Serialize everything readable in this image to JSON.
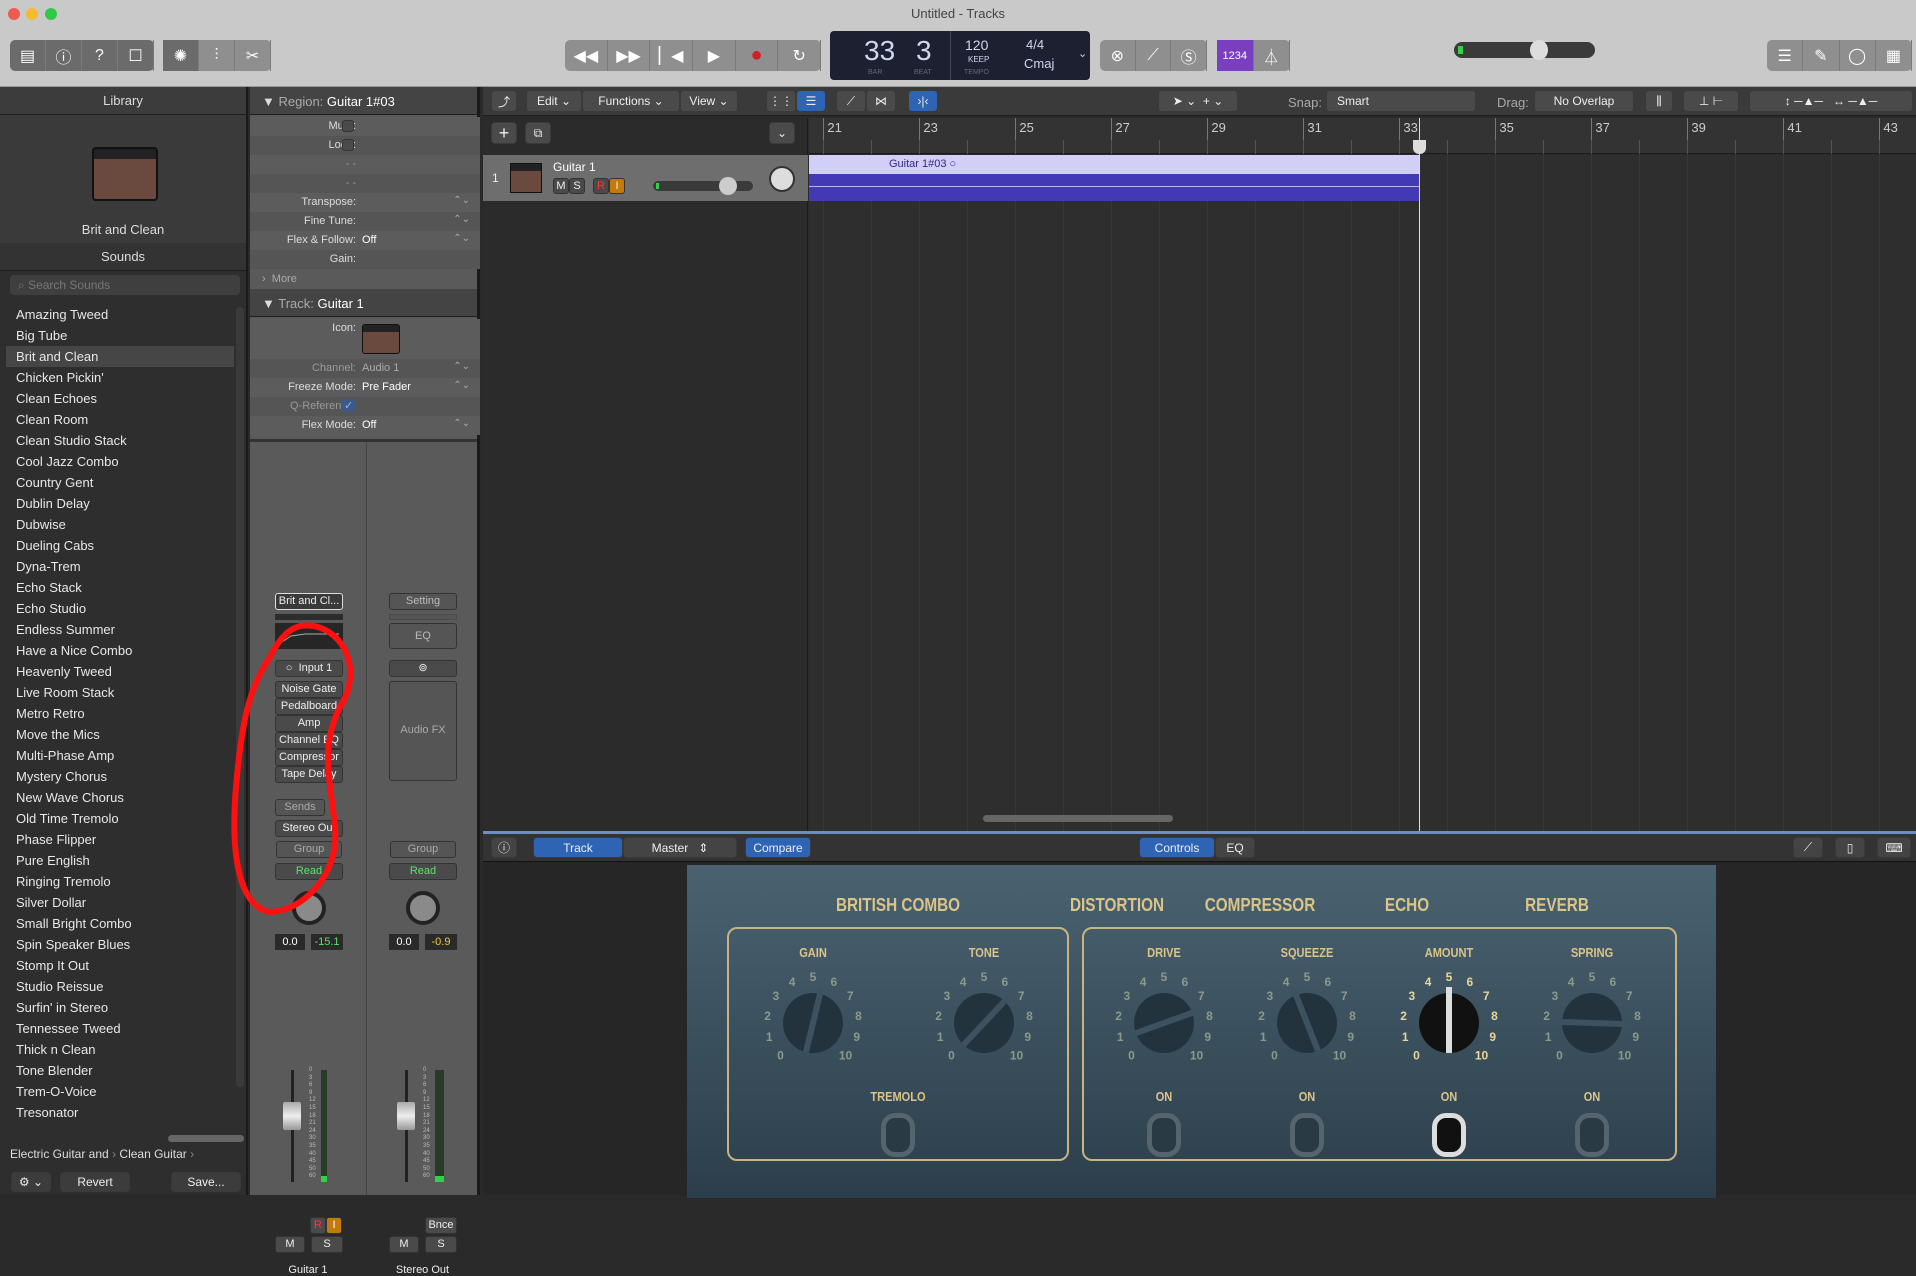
{
  "window": {
    "title": "Untitled - Tracks"
  },
  "colors": {
    "region_header": "#d2cff6",
    "region_body": "#4439b5",
    "accent_blue": "#2f64b4",
    "plugin_gold": "#d9c48a",
    "record": "#d02020",
    "count_in_purple": "#7a3fc0"
  },
  "toolbar": {
    "left_icons": [
      "library-icon",
      "inspector-icon",
      "quick-help-icon",
      "toolbar-icon"
    ],
    "edit_icons": [
      "smart-controls-icon",
      "mixer-icon",
      "editors-scissors-icon"
    ],
    "transport": [
      "rewind-icon",
      "fast-forward-icon",
      "go-to-start-icon",
      "play-icon",
      "record-icon",
      "cycle-icon"
    ],
    "lcd": {
      "bar": "33",
      "beat": "3",
      "bar_label": "BAR",
      "beat_label": "BEAT",
      "tempo": "120",
      "keep": "KEEP",
      "tempo_label": "TEMPO",
      "signature": "4/4",
      "key": "Cmaj"
    },
    "mode_icons": [
      "replace-icon",
      "tuner-icon",
      "solo-icon"
    ],
    "count_in": "1234",
    "master_volume": 0.6,
    "right_icons": [
      "list-editors-icon",
      "notepad-icon",
      "loop-browser-icon",
      "browser-icon"
    ]
  },
  "library": {
    "header": "Library",
    "patch_name": "Brit and Clean",
    "sounds_label": "Sounds",
    "search_placeholder": "Search Sounds",
    "items": [
      "Amazing Tweed",
      "Big Tube",
      "Brit and Clean",
      "Chicken Pickin'",
      "Clean Echoes",
      "Clean Room",
      "Clean Studio Stack",
      "Cool Jazz Combo",
      "Country Gent",
      "Dublin Delay",
      "Dubwise",
      "Dueling Cabs",
      "Dyna-Trem",
      "Echo Stack",
      "Echo Studio",
      "Endless Summer",
      "Have a Nice Combo",
      "Heavenly Tweed",
      "Live Room Stack",
      "Metro Retro",
      "Move the Mics",
      "Multi-Phase Amp",
      "Mystery Chorus",
      "New Wave Chorus",
      "Old Time Tremolo",
      "Phase Flipper",
      "Pure English",
      "Ringing Tremolo",
      "Silver Dollar",
      "Small Bright Combo",
      "Spin Speaker Blues",
      "Stomp It Out",
      "Studio Reissue",
      "Surfin' in Stereo",
      "Tennessee Tweed",
      "Thick n Clean",
      "Tone Blender",
      "Trem-O-Voice",
      "Tresonator"
    ],
    "selected": "Brit and Clean",
    "breadcrumb": [
      "Electric Guitar and",
      "Clean Guitar"
    ],
    "revert": "Revert",
    "save": "Save..."
  },
  "inspector": {
    "region_label": "Region:",
    "region_name": "Guitar 1#03",
    "region_rows": [
      {
        "label": "Mute:",
        "value": ""
      },
      {
        "label": "Loop:",
        "value": ""
      },
      {
        "label": "- -",
        "value": ""
      },
      {
        "label": "- -",
        "value": ""
      },
      {
        "label": "Transpose:",
        "value": ""
      },
      {
        "label": "Fine Tune:",
        "value": ""
      },
      {
        "label": "Flex & Follow:",
        "value": "Off"
      },
      {
        "label": "Gain:",
        "value": ""
      }
    ],
    "more": "More",
    "track_label": "Track:",
    "track_name": "Guitar 1",
    "track_rows": [
      {
        "label": "Icon:",
        "value": ""
      },
      {
        "label": "Channel:",
        "value": "Audio 1"
      },
      {
        "label": "Freeze Mode:",
        "value": "Pre Fader"
      },
      {
        "label": "Q-Reference:",
        "value": "✓"
      },
      {
        "label": "Flex Mode:",
        "value": "Off"
      }
    ],
    "strip1": {
      "setting": "Brit and Cl...",
      "input": "Input 1",
      "plugins": [
        "Noise Gate",
        "Pedalboard",
        "Amp",
        "Channel EQ",
        "Compressor",
        "Tape Delay"
      ],
      "sends": "Sends",
      "output": "Stereo Out",
      "group": "Group",
      "automation": "Read",
      "volume": "0.0",
      "peak": "-15.1",
      "r": "R",
      "i": "I",
      "m": "M",
      "s": "S",
      "name": "Guitar 1"
    },
    "strip2": {
      "setting": "Setting",
      "eq": "EQ",
      "audio_fx": "Audio FX",
      "group": "Group",
      "automation": "Read",
      "volume": "0.0",
      "peak": "-0.9",
      "bnce": "Bnce",
      "m": "M",
      "s": "S",
      "name": "Stereo Out"
    },
    "meter_scale": [
      "0",
      "3",
      "6",
      "9",
      "12",
      "15",
      "18",
      "21",
      "24",
      "30",
      "35",
      "40",
      "45",
      "50",
      "60"
    ]
  },
  "tracks": {
    "menus": [
      "Edit",
      "Functions",
      "View"
    ],
    "snap_label": "Snap:",
    "snap": "Smart",
    "drag_label": "Drag:",
    "drag": "No Overlap",
    "ruler": [
      "21",
      "23",
      "25",
      "27",
      "29",
      "31",
      "33",
      "35",
      "37",
      "39",
      "41",
      "43"
    ],
    "playhead_bar": 33.4,
    "track": {
      "number": "1",
      "name": "Guitar 1",
      "m": "M",
      "s": "S",
      "r": "R",
      "i": "I",
      "volume": 0.75
    },
    "region": {
      "name": "Guitar 1#03",
      "start_bar": 20.7,
      "end_bar": 33.4
    }
  },
  "smart_controls": {
    "tabs": [
      "Track",
      "Master"
    ],
    "compare": "Compare",
    "view_tabs": [
      "Controls",
      "EQ"
    ],
    "titles": [
      "BRITISH COMBO",
      "DISTORTION",
      "COMPRESSOR",
      "ECHO",
      "REVERB"
    ],
    "knobs": [
      {
        "label": "GAIN",
        "value": 5.5
      },
      {
        "label": "TONE",
        "value": 6.6
      },
      {
        "label": "DRIVE",
        "value": 7.6
      },
      {
        "label": "SQUEEZE",
        "value": 4.2
      },
      {
        "label": "AMOUNT",
        "value": 5.0,
        "active": true
      },
      {
        "label": "SPRING",
        "value": 8.4
      }
    ],
    "switches": [
      {
        "label": "TREMOLO",
        "on": false
      },
      {
        "label": "ON",
        "on": false
      },
      {
        "label": "ON",
        "on": false
      },
      {
        "label": "ON",
        "on": true
      },
      {
        "label": "ON",
        "on": false
      }
    ]
  }
}
